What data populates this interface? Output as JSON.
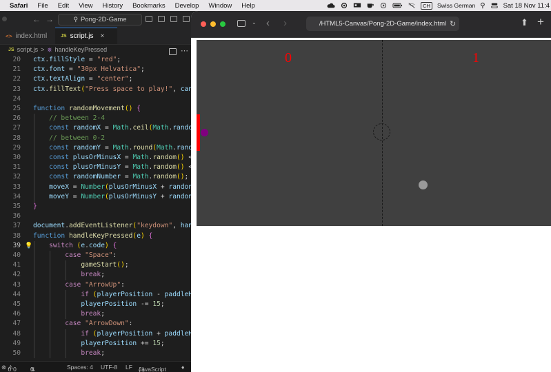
{
  "menubar": {
    "app_name": "Safari",
    "items": [
      "File",
      "Edit",
      "View",
      "History",
      "Bookmarks",
      "Develop",
      "Window",
      "Help"
    ],
    "input_source_badge": "CH",
    "input_source_label": "Swiss German",
    "clock": "Sat 18 Nov  11:4",
    "status_icons": [
      "cloud-icon",
      "creative-cloud-icon",
      "monitor-icon",
      "coffee-cup-icon",
      "play-circle-icon",
      "battery-icon",
      "wifi-off-icon",
      "search-icon",
      "control-center-icon"
    ]
  },
  "vscode": {
    "search_text": "Pong-2D-Game",
    "tabs": [
      {
        "icon": "<>",
        "label": "index.html"
      },
      {
        "icon": "JS",
        "label": "script.js",
        "close": "×"
      }
    ],
    "breadcrumb": {
      "icon": "JS",
      "file": "script.js",
      "separator": ">",
      "symbol": "handleKeyPressed"
    },
    "current_line": "39",
    "lines": [
      {
        "n": "20",
        "text": "ctx.fillStyle = \"red\";"
      },
      {
        "n": "21",
        "text": "ctx.font = \"30px Helvatica\";"
      },
      {
        "n": "22",
        "text": "ctx.textAlign = \"center\";"
      },
      {
        "n": "23",
        "text": "ctx.fillText(\"Press space to play!\", can"
      },
      {
        "n": "24",
        "text": ""
      },
      {
        "n": "25",
        "text": "function randomMovement() {"
      },
      {
        "n": "26",
        "text": "    // between 2-4"
      },
      {
        "n": "27",
        "text": "    const randomX = Math.ceil(Math.rando"
      },
      {
        "n": "28",
        "text": "    // between 0-2"
      },
      {
        "n": "29",
        "text": "    const randomY = Math.round(Math.rand"
      },
      {
        "n": "30",
        "text": "    const plusOrMinusX = Math.random() <"
      },
      {
        "n": "31",
        "text": "    const plusOrMinusY = Math.random() <"
      },
      {
        "n": "32",
        "text": "    const randomNumber = Math.random();"
      },
      {
        "n": "33",
        "text": "    moveX = Number(plusOrMinusX + randon"
      },
      {
        "n": "34",
        "text": "    moveY = Number(plusOrMinusY + randon"
      },
      {
        "n": "35",
        "text": "}"
      },
      {
        "n": "36",
        "text": ""
      },
      {
        "n": "37",
        "text": "document.addEventListener(\"keydown\", han"
      },
      {
        "n": "38",
        "text": "function handleKeyPressed(e) {"
      },
      {
        "n": "39",
        "text": "    switch (e.code) {"
      },
      {
        "n": "40",
        "text": "        case \"Space\":"
      },
      {
        "n": "41",
        "text": "            gameStart();"
      },
      {
        "n": "42",
        "text": "            break;"
      },
      {
        "n": "43",
        "text": "        case \"ArrowUp\":"
      },
      {
        "n": "44",
        "text": "            if (playerPosition - paddleH"
      },
      {
        "n": "45",
        "text": "            playerPosition -= 15;"
      },
      {
        "n": "46",
        "text": "            break;"
      },
      {
        "n": "47",
        "text": "        case \"ArrowDown\":"
      },
      {
        "n": "48",
        "text": "            if (playerPosition + paddleH"
      },
      {
        "n": "49",
        "text": "            playerPosition += 15;"
      },
      {
        "n": "50",
        "text": "            break;"
      }
    ],
    "status": {
      "errors": "0",
      "warnings": "0",
      "ports": "0",
      "spaces": "Spaces: 4",
      "encoding": "UTF-8",
      "eol": "LF",
      "language": "JavaScript"
    }
  },
  "safari": {
    "url": "/HTML5-Canvas/Pong-2D-Game/index.html",
    "traffic_colors": [
      "#ff5f57",
      "#febc2e",
      "#28c840"
    ]
  },
  "game": {
    "score_left": "0",
    "score_right": "1",
    "colors": {
      "background": "#404040",
      "paddle": "#ff0000",
      "score": "#ff0000",
      "ball_left": "#800080",
      "ball_right": "#9a9a9a"
    }
  }
}
